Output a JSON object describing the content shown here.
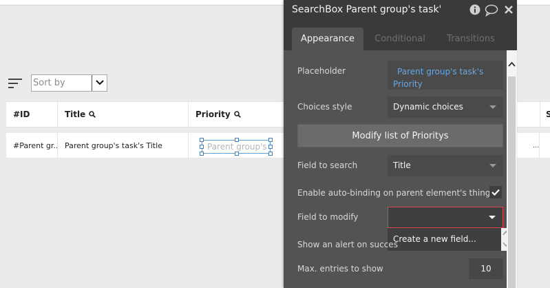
{
  "canvas": {
    "sort_placeholder": "Sort by",
    "table": {
      "headers": [
        "#ID",
        "Title",
        "Priority"
      ],
      "status_header_partial": "Sta",
      "row": [
        "#Parent gr...",
        "Parent group's task's Title"
      ],
      "row_end_partial": "...",
      "searchbox_placeholder": "Parent group's"
    }
  },
  "panel": {
    "title": "SearchBox Parent group's task'",
    "tabs": [
      {
        "label": "Appearance",
        "active": true
      },
      {
        "label": "Conditional",
        "active": false
      },
      {
        "label": "Transitions",
        "active": false
      }
    ],
    "properties": {
      "placeholder_label": "Placeholder",
      "placeholder_value": "Parent group's task's Priority",
      "choices_style_label": "Choices style",
      "choices_style_value": "Dynamic choices",
      "modify_list_button": "Modify list of Prioritys",
      "field_to_search_label": "Field to search",
      "field_to_search_value": "Title",
      "auto_binding_label": "Enable auto-binding on parent element's thing",
      "auto_binding_checked": true,
      "field_to_modify_label": "Field to modify",
      "field_to_modify_value": "",
      "dropdown_option": "Create a new field...",
      "show_alert_label": "Show an alert on succes",
      "max_entries_label": "Max. entries to show",
      "max_entries_value": "10"
    }
  },
  "colors": {
    "panel_bg": "#535353",
    "panel_header": "#3a3a3a",
    "dynamic_text": "#67a8e6",
    "error_border": "#d9474b",
    "selection_blue": "#3d7fc0"
  },
  "icons": [
    "info-icon",
    "comment-icon",
    "close-icon",
    "search-icon",
    "sort-icon",
    "checkmark-icon",
    "chevron-up-icon",
    "chevron-down-icon"
  ]
}
